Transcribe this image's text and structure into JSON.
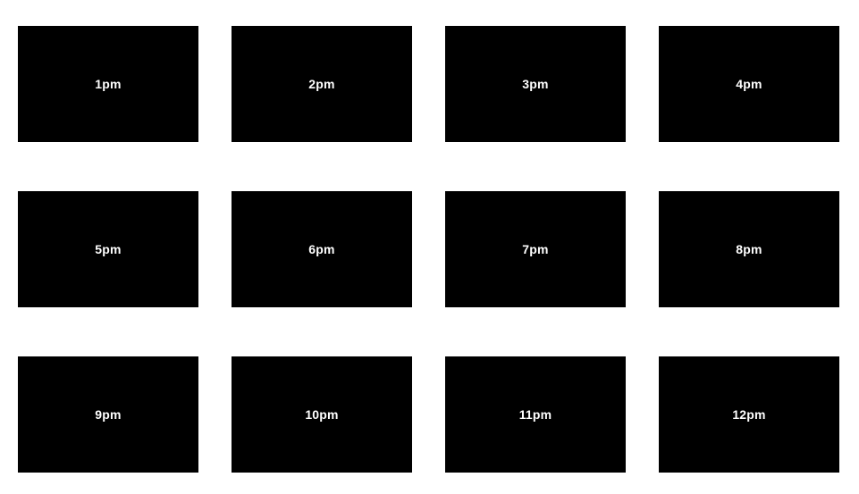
{
  "tiles": [
    {
      "label": "1pm"
    },
    {
      "label": "2pm"
    },
    {
      "label": "3pm"
    },
    {
      "label": "4pm"
    },
    {
      "label": "5pm"
    },
    {
      "label": "6pm"
    },
    {
      "label": "7pm"
    },
    {
      "label": "8pm"
    },
    {
      "label": "9pm"
    },
    {
      "label": "10pm"
    },
    {
      "label": "11pm"
    },
    {
      "label": "12pm"
    }
  ],
  "colors": {
    "background": "#ffffff",
    "tile": "#000000",
    "label": "#ffffff"
  }
}
